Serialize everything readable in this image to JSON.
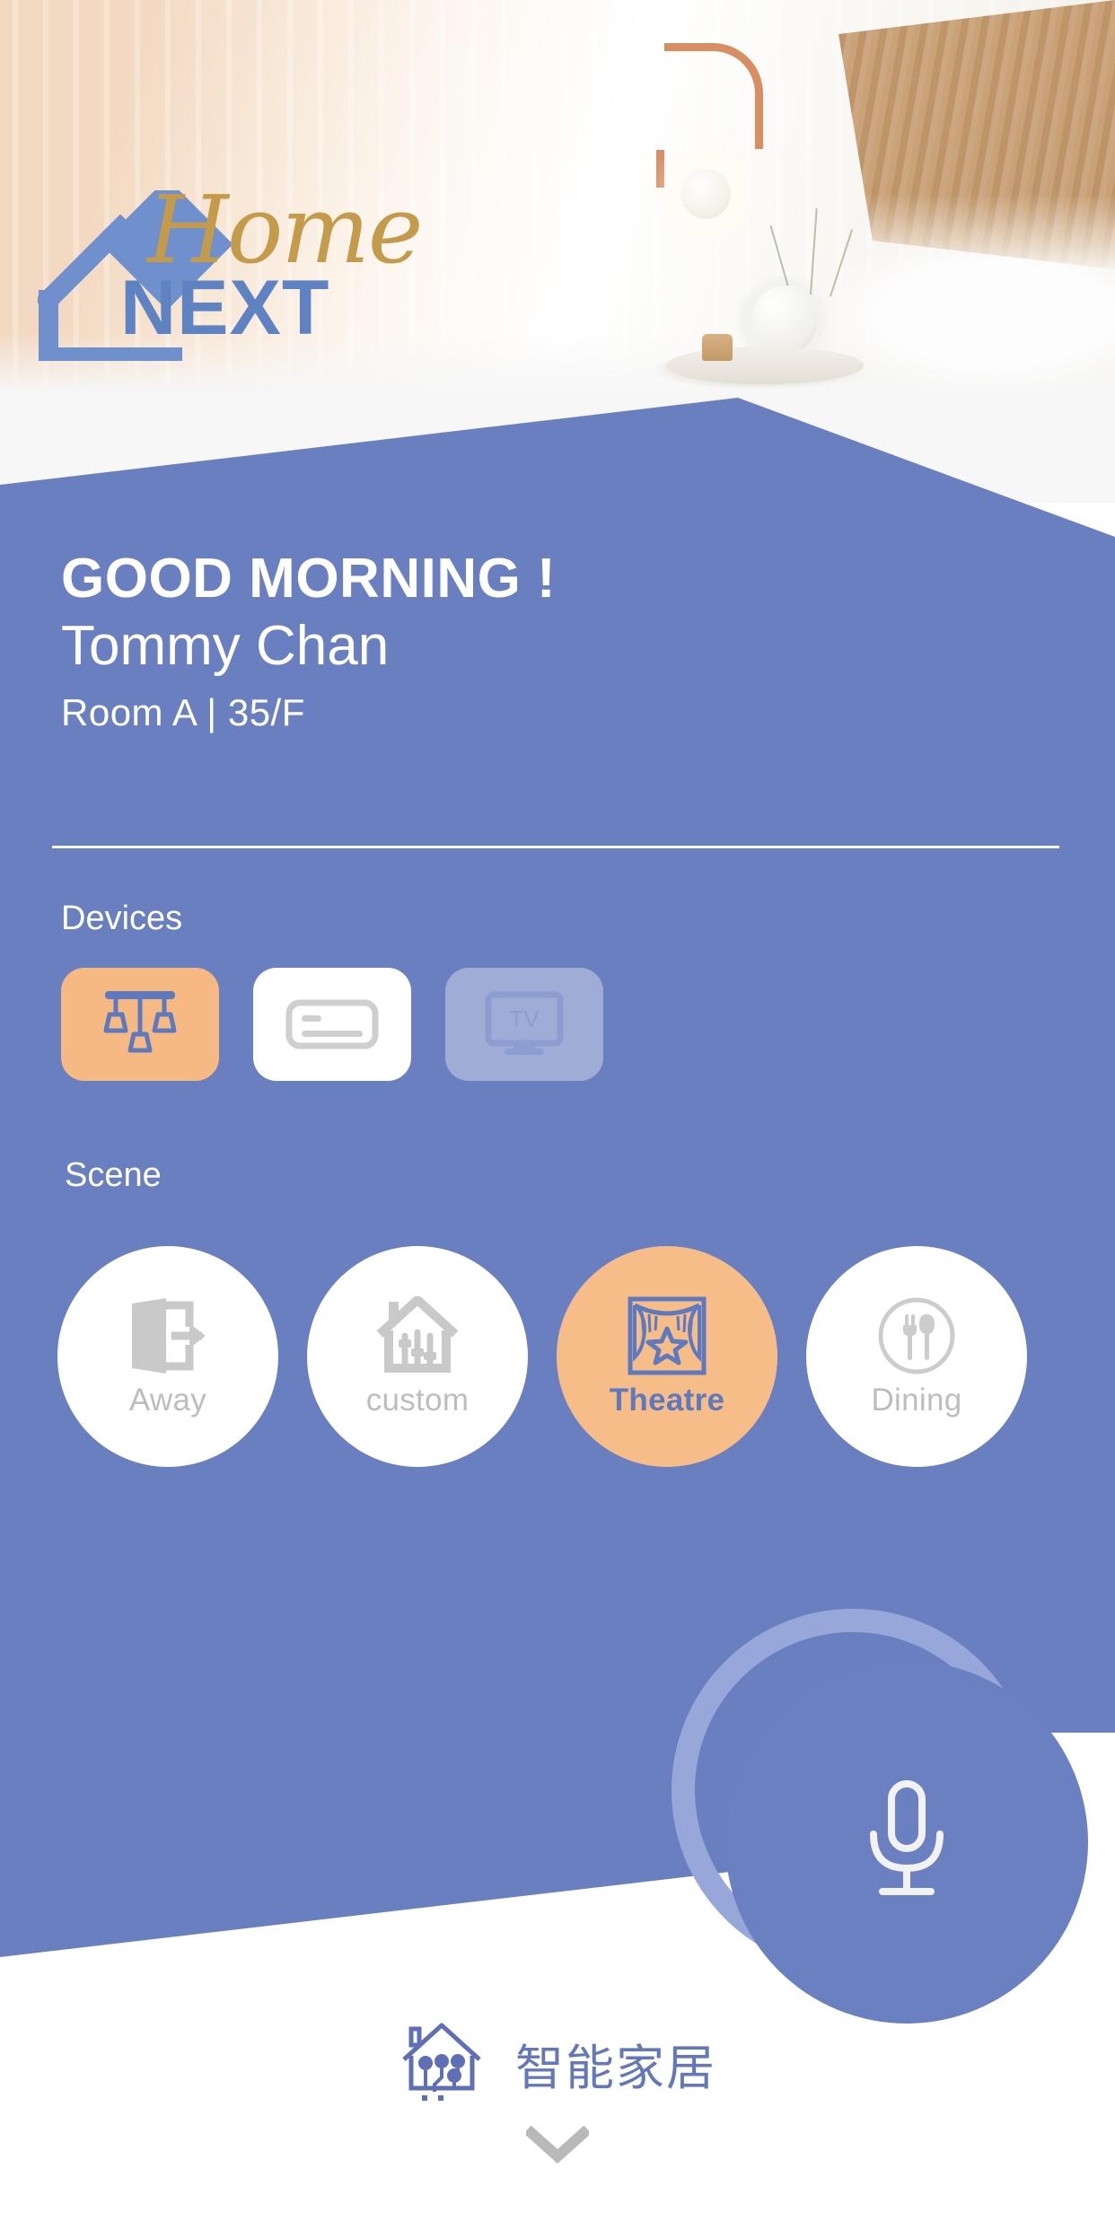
{
  "brand": {
    "logo_word_script": "Home",
    "logo_word_bold": "NEXT",
    "house_icon": "house-outline-icon",
    "accent_gold": "#c49a4b",
    "accent_blue": "#5f82c2"
  },
  "theme": {
    "panel_blue": "#6a7fc0",
    "accent_orange": "#f7b983",
    "white": "#ffffff",
    "muted_grey": "#bdbdbd",
    "disabled_tile": "#9facd6"
  },
  "greeting": {
    "salutation": "GOOD MORNING !",
    "user_name": "Tommy Chan",
    "location": "Room A | 35/F"
  },
  "devices": {
    "label": "Devices",
    "items": [
      {
        "name": "light",
        "icon": "pendant-lights-icon",
        "state": "active",
        "label": ""
      },
      {
        "name": "air-conditioner",
        "icon": "air-conditioner-icon",
        "state": "on",
        "label": ""
      },
      {
        "name": "tv",
        "icon": "tv-icon",
        "state": "off",
        "label": "TV"
      }
    ]
  },
  "scene": {
    "label": "Scene",
    "items": [
      {
        "label": "Away",
        "icon": "door-exit-icon",
        "state": "inactive"
      },
      {
        "label": "custom",
        "icon": "house-sliders-icon",
        "state": "inactive"
      },
      {
        "label": "Theatre",
        "icon": "stage-curtain-star-icon",
        "state": "active"
      },
      {
        "label": "Dining",
        "icon": "fork-spoon-circle-icon",
        "state": "inactive"
      }
    ]
  },
  "voice": {
    "button_name": "microphone-button",
    "icon": "microphone-icon"
  },
  "bottom": {
    "icon": "smart-home-circuit-icon",
    "label": "智能家居",
    "chevron": "chevron-down-icon"
  }
}
